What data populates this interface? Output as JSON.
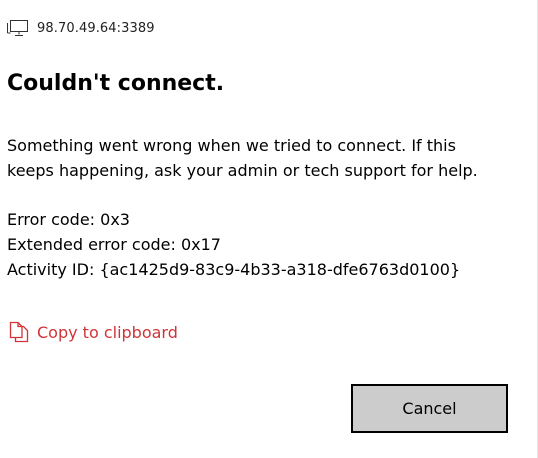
{
  "titlebar": {
    "host": "98.70.49.64:3389",
    "icon": "monitor-icon"
  },
  "heading": "Couldn't connect.",
  "message": "Something went wrong when we tried to connect. If this keeps happening, ask your admin or tech support for help.",
  "details": {
    "error_code": "Error code: 0x3",
    "extended_error_code": "Extended error code: 0x17",
    "activity_id": "Activity ID: {ac1425d9-83c9-4b33-a318-dfe6763d0100}"
  },
  "copy": {
    "label": "Copy to clipboard",
    "icon": "copy-icon",
    "color": "#d13438"
  },
  "buttons": {
    "cancel_label": "Cancel"
  }
}
